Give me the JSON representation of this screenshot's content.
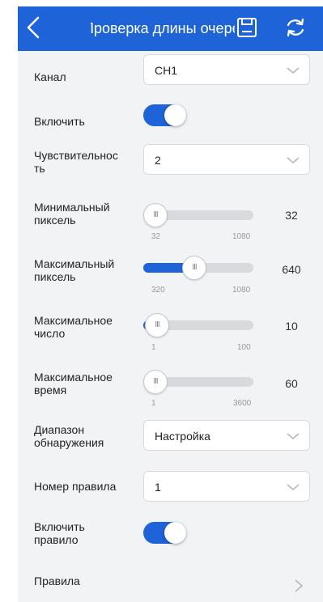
{
  "header": {
    "title": "Проверка длины очереди",
    "back_icon": "chevron-left-icon",
    "save_icon": "save-icon",
    "refresh_icon": "refresh-icon",
    "color": "#1e64d8"
  },
  "fields": {
    "channel": {
      "label": "Канал",
      "value": "CH1"
    },
    "enable": {
      "label": "Включить",
      "on": true
    },
    "sensitivity": {
      "label_line1": "Чувствительнос",
      "label_line2": "ть",
      "value": "2"
    },
    "min_pixel": {
      "label_line1": "Минимальный",
      "label_line2": "пиксель",
      "min": "32",
      "max": "1080",
      "value": "32"
    },
    "max_pixel": {
      "label_line1": "Максимальный",
      "label_line2": "пиксель",
      "min": "320",
      "max": "1080",
      "value": "640"
    },
    "max_count": {
      "label_line1": "Максимальное",
      "label_line2": "число",
      "min": "1",
      "max": "100",
      "value": "10"
    },
    "max_time": {
      "label_line1": "Максимальное",
      "label_line2": "время",
      "min": "1",
      "max": "3600",
      "value": "60"
    },
    "detection_range": {
      "label_line1": "Диапазон",
      "label_line2": "обнаружения",
      "value": "Настройка"
    },
    "rule_number": {
      "label": "Номер правила",
      "value": "1"
    },
    "enable_rule": {
      "label_line1": "Включить",
      "label_line2": "правило",
      "on": true
    },
    "rules": {
      "label": "Правила"
    }
  }
}
